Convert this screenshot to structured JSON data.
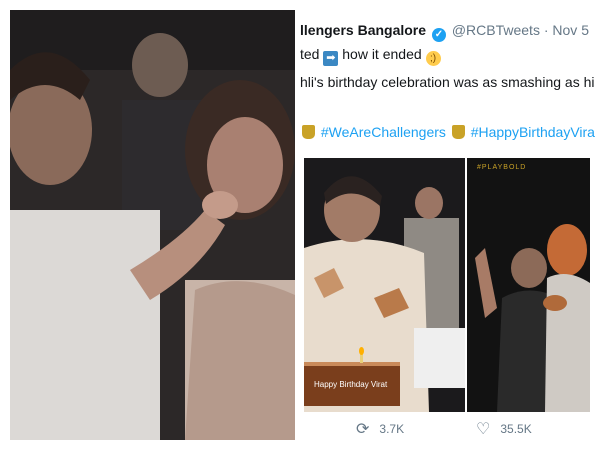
{
  "tweet": {
    "author_name": "llengers Bangalore",
    "verified_icon": "verified-badge-icon",
    "handle": "@RCBTweets",
    "separator": "·",
    "date": "Nov 5",
    "line2_start": "ted",
    "arrow_icon": "right-arrow-emoji",
    "arrow_glyph": "➡",
    "line2_end": "how it ended",
    "wink_icon": "winking-face-emoji",
    "wink_glyph": ";)",
    "line3": "hli's birthday celebration was as smashing as his",
    "hashtag1": "#WeAreChallengers",
    "hashtag2": "#HappyBirthdayViratK",
    "trophy_icon": "trophy-emoji",
    "image_logo_text": "#PLAYBOLD",
    "cake_text": "Happy Birthday Virat"
  },
  "actions": {
    "retweet_icon": "retweet-icon",
    "retweet_glyph": "⟳",
    "retweet_count": "3.7K",
    "like_icon": "heart-outline-icon",
    "like_glyph": "♡",
    "like_count": "35.5K"
  },
  "colors": {
    "link_blue": "#1da1f2",
    "meta_grey": "#657786",
    "text_dark": "#14171a"
  }
}
